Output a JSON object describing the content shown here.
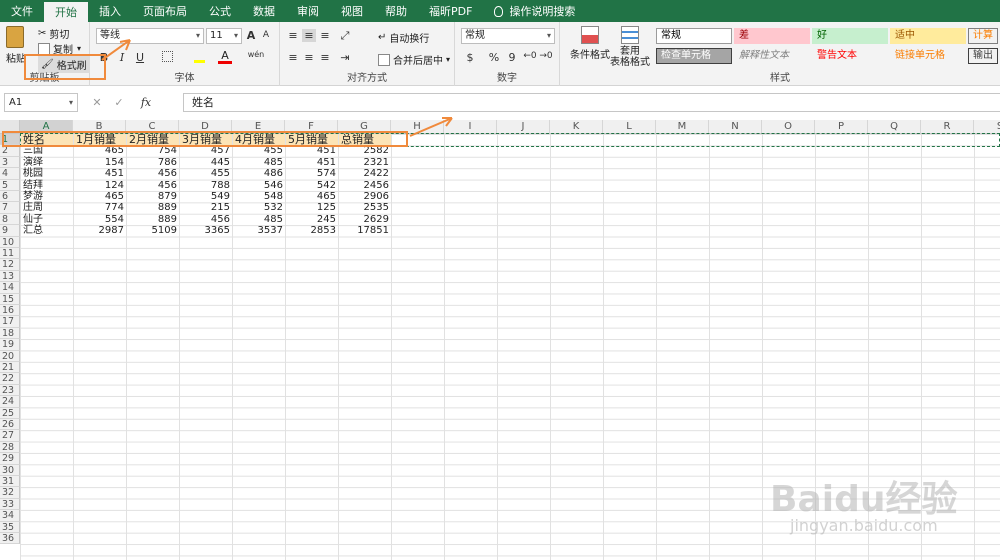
{
  "tabs": [
    "文件",
    "开始",
    "插入",
    "页面布局",
    "公式",
    "数据",
    "审阅",
    "视图",
    "帮助",
    "福昕PDF"
  ],
  "active_tab": "开始",
  "tell_me": "操作说明搜索",
  "clipboard": {
    "paste": "粘贴",
    "cut": "剪切",
    "copy": "复制",
    "format_painter": "格式刷",
    "label": "剪贴板"
  },
  "font": {
    "name": "等线",
    "size": "11",
    "grow": "A",
    "shrink": "A",
    "bold": "B",
    "italic": "I",
    "underline": "U",
    "color_a": "A",
    "wen": "wén",
    "label": "字体"
  },
  "alignment": {
    "wrap": "自动换行",
    "merge": "合并后居中",
    "label": "对齐方式"
  },
  "number": {
    "format": "常规",
    "percent": "%",
    "comma": "9",
    "label": "数字"
  },
  "styles": {
    "cond_format": "条件格式",
    "table_format": "套用\n表格格式",
    "boxes": [
      {
        "text": "常规",
        "bg": "#ffffff",
        "fg": "#000000",
        "border": "#9b9b9b"
      },
      {
        "text": "差",
        "bg": "#ffc7ce",
        "fg": "#9c0006",
        "border": "#ffc7ce"
      },
      {
        "text": "好",
        "bg": "#c6efce",
        "fg": "#006100",
        "border": "#c6efce"
      },
      {
        "text": "适中",
        "bg": "#ffeb9c",
        "fg": "#9c5700",
        "border": "#ffeb9c"
      },
      {
        "text": "计算",
        "bg": "#f2f2f2",
        "fg": "#fa7d00",
        "border": "#7f7f7f"
      },
      {
        "text": "检查单元格",
        "bg": "#a5a5a5",
        "fg": "#ffffff",
        "border": "#3f3f3f"
      },
      {
        "text": "解释性文本",
        "bg": "#f3f3f3",
        "fg": "#7f7f7f",
        "border": "#f3f3f3"
      },
      {
        "text": "警告文本",
        "bg": "#f3f3f3",
        "fg": "#ff0000",
        "border": "#f3f3f3"
      },
      {
        "text": "链接单元格",
        "bg": "#f3f3f3",
        "fg": "#fa7d00",
        "border": "#f3f3f3"
      },
      {
        "text": "输出",
        "bg": "#f2f2f2",
        "fg": "#3f3f3f",
        "border": "#3f3f3f"
      }
    ],
    "label": "样式"
  },
  "formula_bar": {
    "name_box": "A1",
    "fx": "fx",
    "content": "姓名"
  },
  "columns": [
    "A",
    "B",
    "C",
    "D",
    "E",
    "F",
    "G",
    "H",
    "I",
    "J",
    "K",
    "L",
    "M",
    "N",
    "O",
    "P",
    "Q",
    "R",
    "S"
  ],
  "rows": [
    "1",
    "2",
    "3",
    "4",
    "5",
    "6",
    "7",
    "8",
    "9",
    "10",
    "11",
    "12",
    "13",
    "14",
    "15",
    "16",
    "17",
    "18",
    "19",
    "20",
    "21",
    "22",
    "23",
    "24",
    "25",
    "26",
    "27",
    "28",
    "29",
    "30",
    "31",
    "32",
    "33",
    "34",
    "35",
    "36"
  ],
  "table": {
    "header": [
      "姓名",
      "1月销量",
      "2月销量",
      "3月销量",
      "4月销量",
      "5月销量",
      "总销量"
    ],
    "rows": [
      [
        "三国",
        "465",
        "754",
        "457",
        "455",
        "451",
        "2582"
      ],
      [
        "演绎",
        "154",
        "786",
        "445",
        "485",
        "451",
        "2321"
      ],
      [
        "桃园",
        "451",
        "456",
        "455",
        "486",
        "574",
        "2422"
      ],
      [
        "结拜",
        "124",
        "456",
        "788",
        "546",
        "542",
        "2456"
      ],
      [
        "梦游",
        "465",
        "879",
        "549",
        "548",
        "465",
        "2906"
      ],
      [
        "庄周",
        "774",
        "889",
        "215",
        "532",
        "125",
        "2535"
      ],
      [
        "仙子",
        "554",
        "889",
        "456",
        "485",
        "245",
        "2629"
      ],
      [
        "汇总",
        "2987",
        "5109",
        "3365",
        "3537",
        "2853",
        "17851"
      ]
    ]
  },
  "watermark": "Baidu经验",
  "watermark_sub": "jingyan.baidu.com",
  "colors": {
    "excel_green": "#217346",
    "highlight_orange": "#f08a3c",
    "header_fill": "#fce4b6"
  }
}
